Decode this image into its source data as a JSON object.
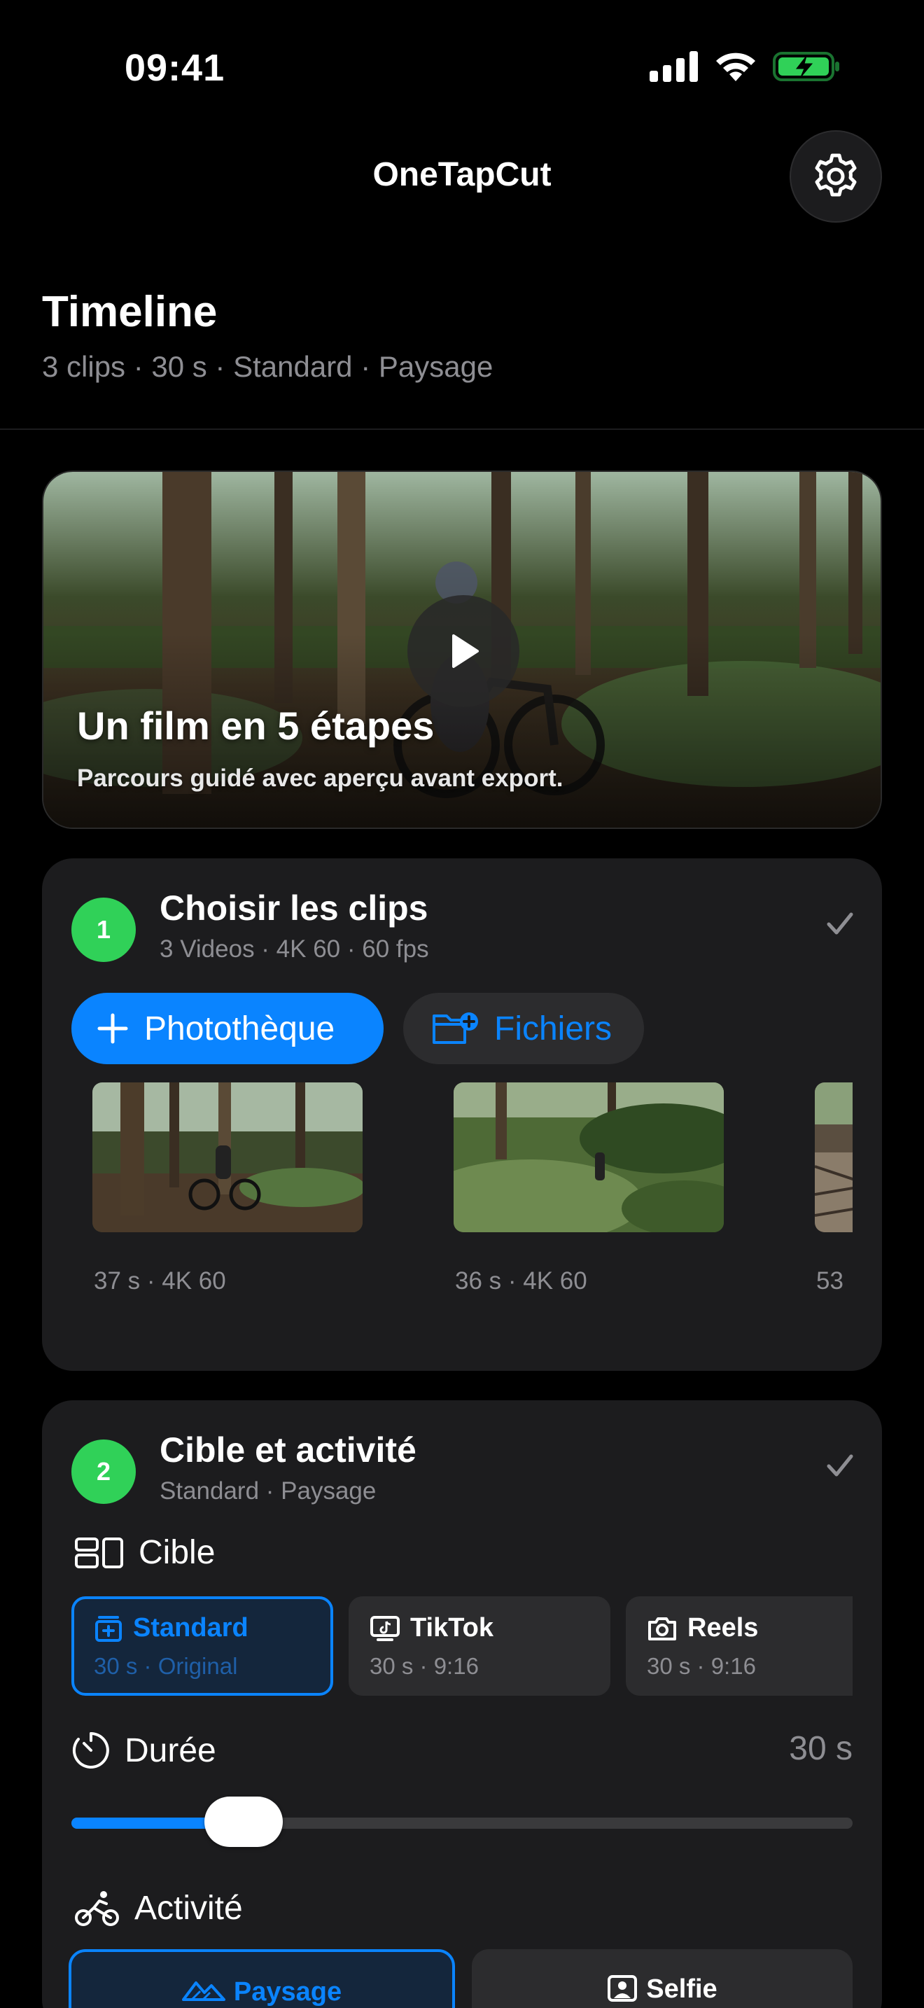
{
  "status_bar": {
    "time": "09:41"
  },
  "nav": {
    "title": "OneTapCut"
  },
  "header": {
    "title": "Timeline",
    "subtitle": "3 clips · 30 s · Standard · Paysage"
  },
  "hero": {
    "title": "Un film en 5 étapes",
    "subtitle": "Parcours guidé avec aperçu avant export."
  },
  "step1": {
    "number": "1",
    "title": "Choisir les clips",
    "subtitle": "3 Videos · 4K 60 · 60 fps",
    "library_button": "Photothèque",
    "files_button": "Fichiers",
    "clips": [
      {
        "meta": "37 s · 4K 60"
      },
      {
        "meta": "36 s · 4K 60"
      },
      {
        "meta": "53"
      }
    ]
  },
  "step2": {
    "number": "2",
    "title": "Cible et activité",
    "subtitle": "Standard · Paysage",
    "target_label": "Cible",
    "targets": [
      {
        "name": "Standard",
        "detail": "30 s · Original",
        "icon": "film-icon",
        "selected": true
      },
      {
        "name": "TikTok",
        "detail": "30 s · 9:16",
        "icon": "tiktok-icon",
        "selected": false
      },
      {
        "name": "Reels",
        "detail": "30 s · 9:16",
        "icon": "camera-icon",
        "selected": false
      }
    ],
    "duration_label": "Durée",
    "duration_value": "30 s",
    "duration_fraction": 0.22,
    "activity_label": "Activité",
    "activities": [
      {
        "name": "Paysage",
        "icon": "mountains-icon",
        "selected": true
      },
      {
        "name": "Selfie",
        "icon": "portrait-icon",
        "selected": false
      }
    ]
  },
  "colors": {
    "accent": "#0a84ff",
    "success": "#30d158",
    "background": "#000000",
    "card": "#1c1c1e"
  }
}
